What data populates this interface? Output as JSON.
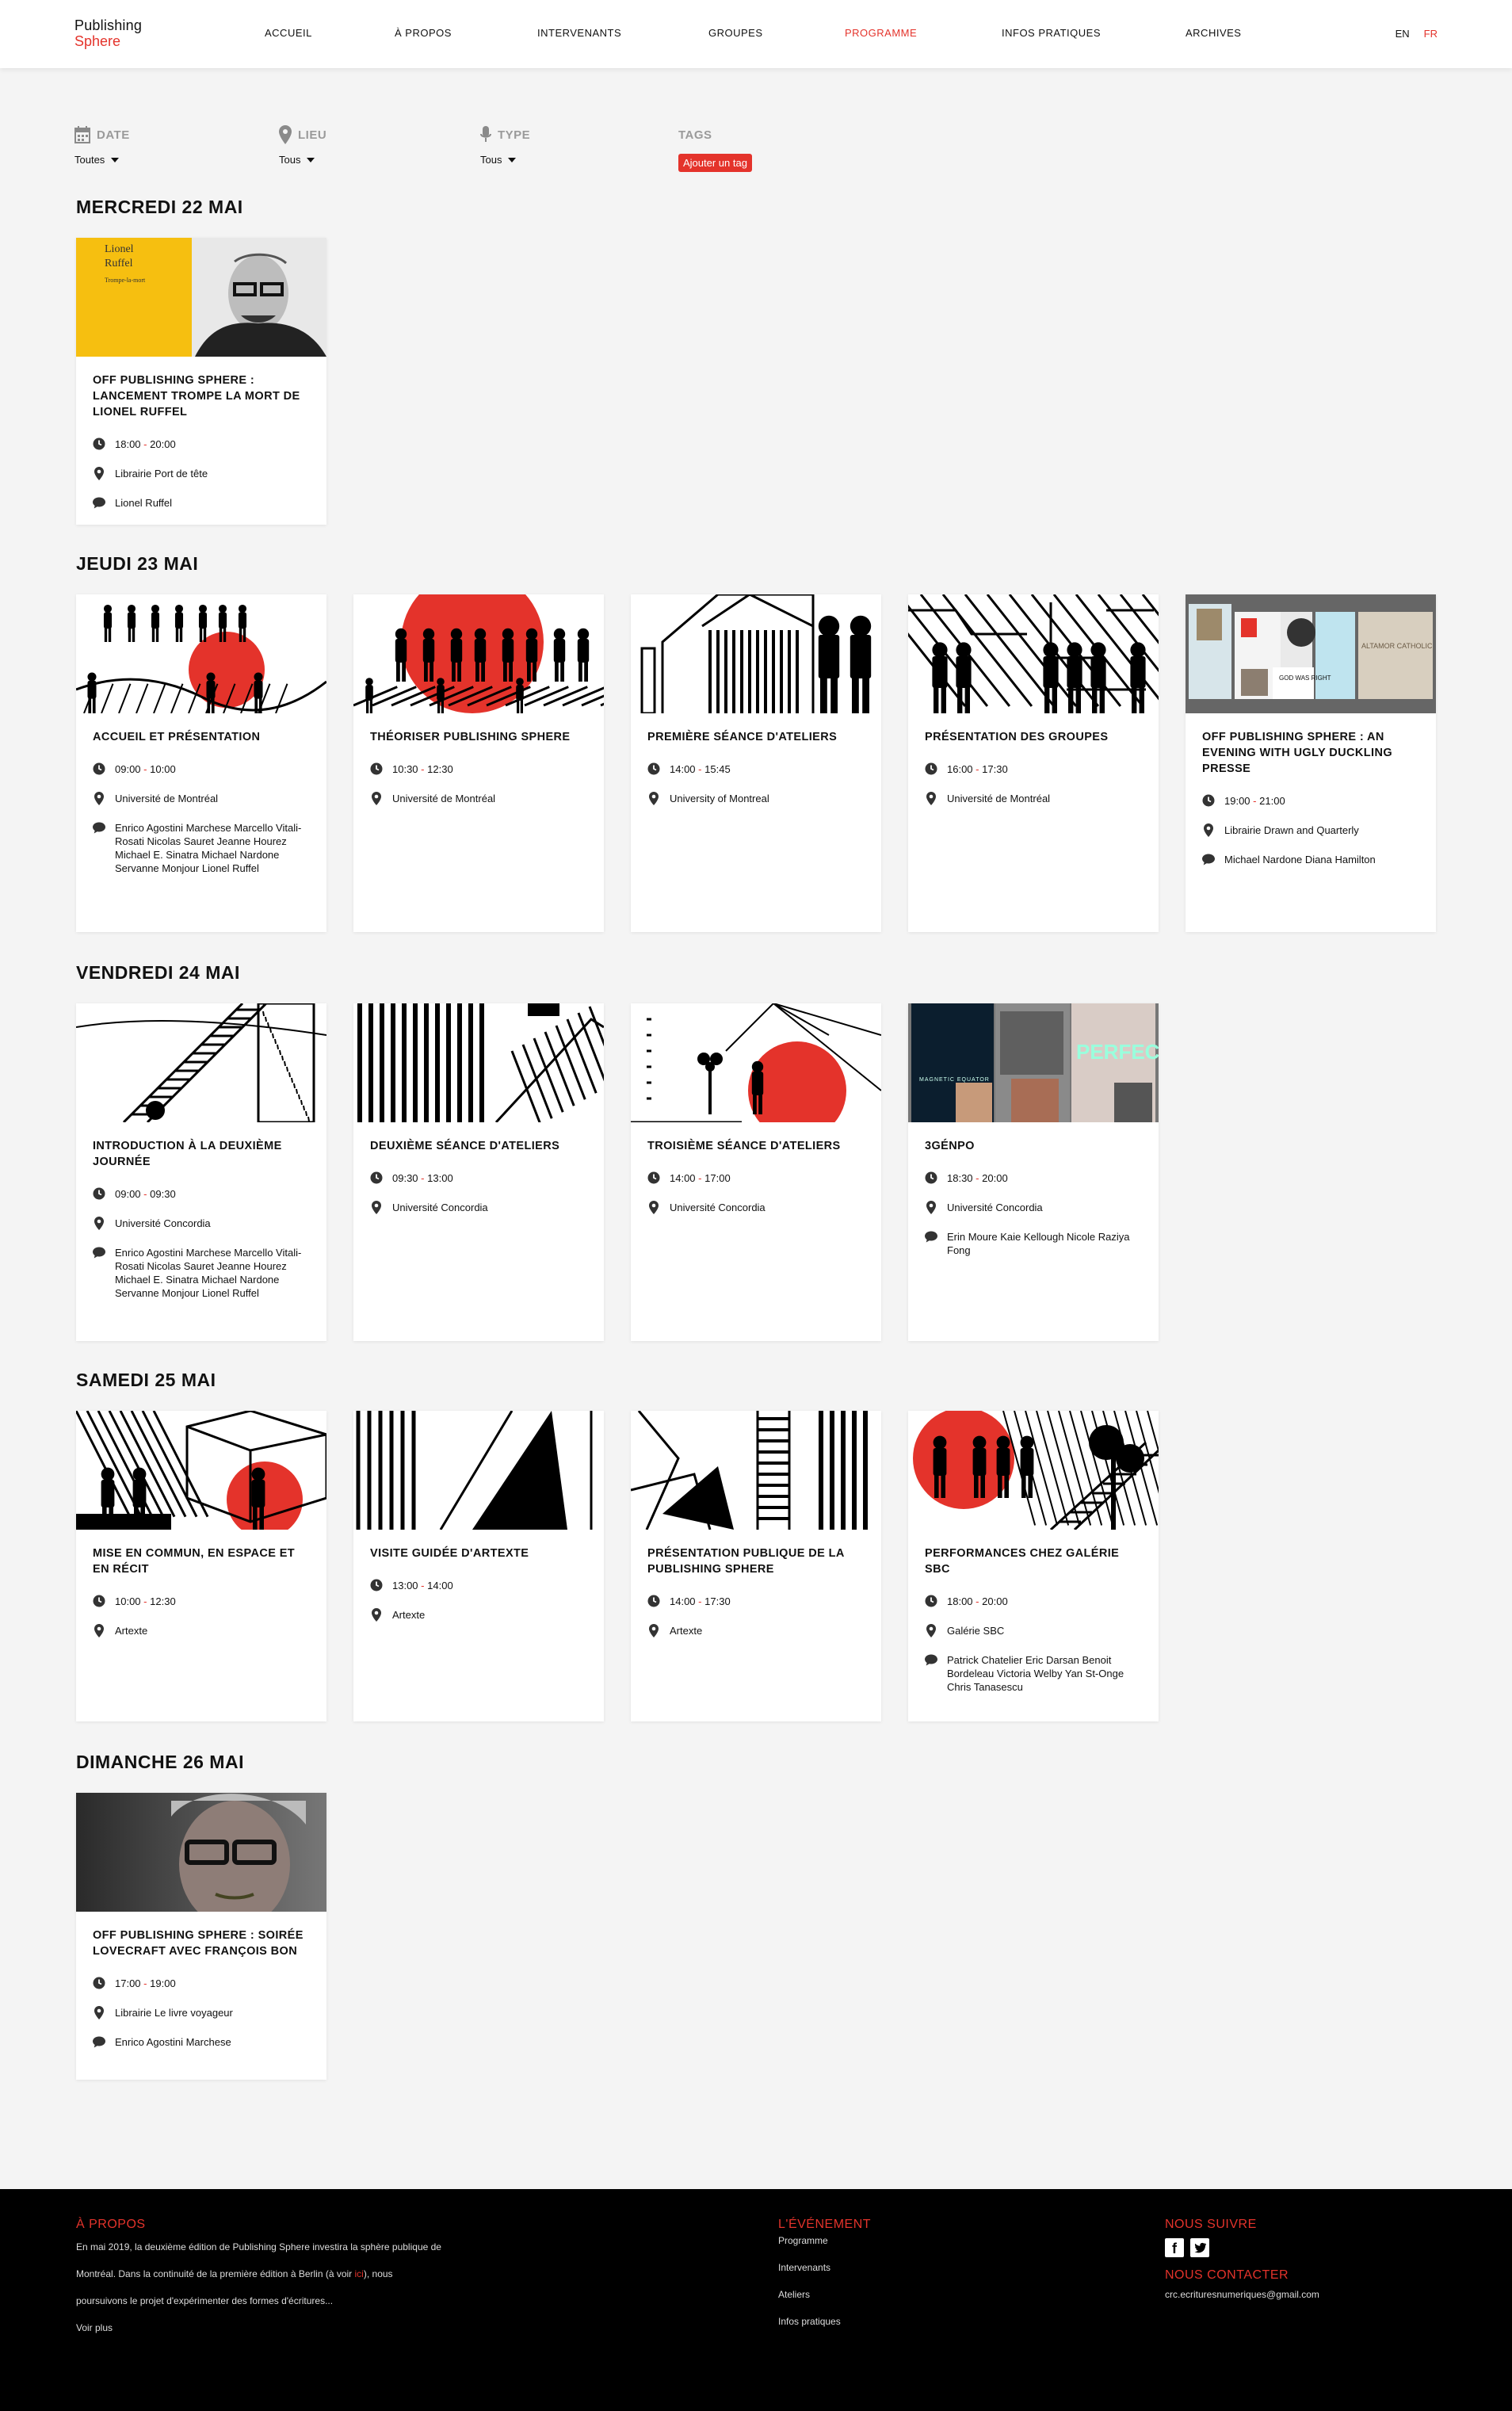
{
  "header": {
    "logo_line1": "Publishing",
    "logo_line2": "Sphere",
    "nav": [
      {
        "label": "ACCUEIL",
        "active": false
      },
      {
        "label": "À PROPOS",
        "active": false
      },
      {
        "label": "INTERVENANTS",
        "active": false
      },
      {
        "label": "GROUPES",
        "active": false
      },
      {
        "label": "PROGRAMME",
        "active": true
      },
      {
        "label": "INFOS PRATIQUES",
        "active": false
      },
      {
        "label": "ARCHIVES",
        "active": false
      }
    ],
    "lang_en": "EN",
    "lang_fr": "FR"
  },
  "filters": {
    "date": {
      "label": "DATE",
      "value": "Toutes"
    },
    "lieu": {
      "label": "LIEU",
      "value": "Tous"
    },
    "type": {
      "label": "TYPE",
      "value": "Tous"
    },
    "tags": {
      "label": "TAGS",
      "button": "Ajouter un tag"
    }
  },
  "days": [
    {
      "title": "MERCREDI 22 MAI",
      "events": [
        {
          "title": "OFF PUBLISHING SPHERE : LANCEMENT TROMPE LA MORT DE LIONEL RUFFEL",
          "time_start": "18:00",
          "time_end": "20:00",
          "place": "Librairie Port de tête",
          "people": "Lionel Ruffel",
          "image": "book-cover-portrait",
          "book_author": "Lionel Ruffel",
          "book_title": "Trompe-la-mort"
        }
      ]
    },
    {
      "title": "JEUDI 23 MAI",
      "events": [
        {
          "title": "ACCUEIL ET PRÉSENTATION",
          "time_start": "09:00",
          "time_end": "10:00",
          "place": "Université de Montréal",
          "people": "Enrico Agostini Marchese  Marcello Vitali-Rosati  Nicolas Sauret  Jeanne Hourez  Michael E. Sinatra  Michael Nardone  Servanne Monjour  Lionel Ruffel",
          "image": "illustration-red-circle"
        },
        {
          "title": "THÉORISER PUBLISHING SPHERE",
          "time_start": "10:30",
          "time_end": "12:30",
          "place": "Université de Montréal",
          "people": "",
          "image": "illustration-crowd-red"
        },
        {
          "title": "PREMIÈRE SÉANCE D'ATELIERS",
          "time_start": "14:00",
          "time_end": "15:45",
          "place": "University of Montreal",
          "people": "",
          "image": "illustration-house"
        },
        {
          "title": "PRÉSENTATION DES GROUPES",
          "time_start": "16:00",
          "time_end": "17:30",
          "place": "Université de Montréal",
          "people": "",
          "image": "illustration-circuit"
        },
        {
          "title": "OFF PUBLISHING SPHERE : AN EVENING WITH UGLY DUCKLING PRESSE",
          "time_start": "19:00",
          "time_end": "21:00",
          "place": "Librairie Drawn and Quarterly",
          "people": "Michael Nardone  Diana Hamilton",
          "image": "collage-books",
          "collage_text_1": "GOD WAS RIGHT",
          "collage_text_2": "ALTAMOR CATHOLIC"
        }
      ]
    },
    {
      "title": "VENDREDI 24 MAI",
      "events": [
        {
          "title": "INTRODUCTION À LA DEUXIÈME JOURNÉE",
          "time_start": "09:00",
          "time_end": "09:30",
          "place": "Université Concordia",
          "people": "Enrico Agostini Marchese  Marcello Vitali-Rosati  Nicolas Sauret  Jeanne Hourez  Michael E. Sinatra  Michael Nardone  Servanne Monjour  Lionel Ruffel",
          "image": "illustration-ladder"
        },
        {
          "title": "DEUXIÈME SÉANCE D'ATELIERS",
          "time_start": "09:30",
          "time_end": "13:00",
          "place": "Université Concordia",
          "people": "",
          "image": "illustration-bars"
        },
        {
          "title": "TROISIÈME SÉANCE D'ATELIERS",
          "time_start": "14:00",
          "time_end": "17:00",
          "place": "Université Concordia",
          "people": "",
          "image": "illustration-digger-red"
        },
        {
          "title": "3GÉNPO",
          "time_start": "18:30",
          "time_end": "20:00",
          "place": "Université Concordia",
          "people": "Erin Moure  Kaie Kellough  Nicole Raziya Fong",
          "image": "collage-covers",
          "collage_text_1": "MAGNETIC EQUATOR",
          "collage_text_2": "PERFECT"
        }
      ]
    },
    {
      "title": "SAMEDI 25 MAI",
      "events": [
        {
          "title": "MISE EN COMMUN, EN ESPACE ET EN RÉCIT",
          "time_start": "10:00",
          "time_end": "12:30",
          "place": "Artexte",
          "people": "",
          "image": "illustration-boxes-red"
        },
        {
          "title": "VISITE GUIDÉE D'ARTEXTE",
          "time_start": "13:00",
          "time_end": "14:00",
          "place": "Artexte",
          "people": "",
          "image": "illustration-triangle"
        },
        {
          "title": "PRÉSENTATION PUBLIQUE DE LA PUBLISHING SPHERE",
          "time_start": "14:00",
          "time_end": "17:30",
          "place": "Artexte",
          "people": "",
          "image": "illustration-stripes"
        },
        {
          "title": "PERFORMANCES CHEZ GALÉRIE SBC",
          "time_start": "18:00",
          "time_end": "20:00",
          "place": "Galérie SBC",
          "people": "Patrick Chatelier  Eric Darsan  Benoit Bordeleau  Victoria Welby  Yan St-Onge  Chris Tanasescu",
          "image": "illustration-tree-red"
        }
      ]
    },
    {
      "title": "DIMANCHE 26 MAI",
      "events": [
        {
          "title": "OFF PUBLISHING SPHERE : SOIRÉE LOVECRAFT AVEC FRANÇOIS BON",
          "time_start": "17:00",
          "time_end": "19:00",
          "place": "Librairie Le livre voyageur",
          "people": "Enrico Agostini Marchese",
          "image": "photo-portrait"
        }
      ]
    }
  ],
  "footer": {
    "about_title": "À PROPOS",
    "about_text_1": "En mai 2019, la deuxième édition de Publishing Sphere investira la sphère publique de",
    "about_text_2a": "Montréal. Dans la continuité de la première édition à Berlin (à voir ",
    "about_link": "ici",
    "about_text_2b": "), nous",
    "about_text_3": "poursuivons le projet d'expérimenter des formes d'écritures...",
    "about_more": "Voir plus",
    "event_title": "L'ÉVÉNEMENT",
    "event_links": [
      "Programme",
      "Intervenants",
      "Ateliers",
      "Infos pratiques"
    ],
    "follow_title": "NOUS SUIVRE",
    "contact_title": "NOUS CONTACTER",
    "contact_email": "crc.ecrituresnumeriques@gmail.com"
  },
  "colors": {
    "accent": "#e4332b",
    "background": "#f4f4f4",
    "footer": "#000000",
    "book_yellow": "#f6bf10"
  }
}
